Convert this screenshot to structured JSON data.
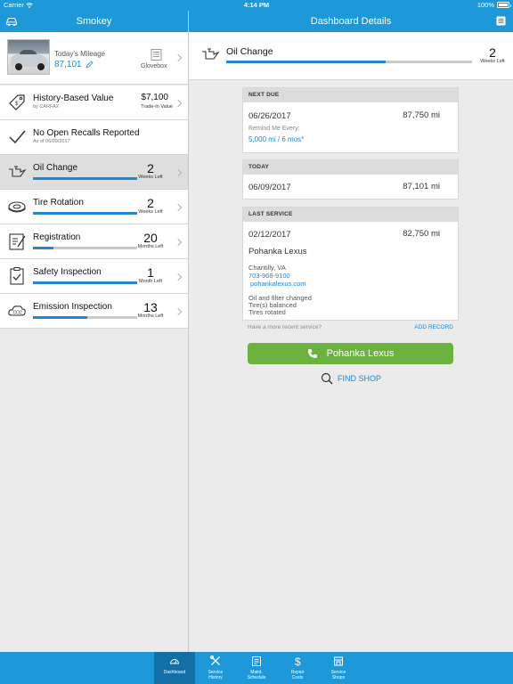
{
  "status_bar": {
    "carrier": "Carrier",
    "time": "4:14 PM",
    "battery": "100%"
  },
  "left_nav": {
    "title": "Smokey",
    "left_icon": "car-icon"
  },
  "right_nav": {
    "title": "Dashboard Details",
    "right_icon": "list-icon"
  },
  "vehicle": {
    "mileage_label": "Today's Mileage",
    "mileage_value": "87,101",
    "glovebox_label": "Glovebox"
  },
  "history_value": {
    "label": "History-Based Value",
    "sub": "by CARFAX",
    "value": "$7,100",
    "value_sub": "Trade-In Value"
  },
  "recalls": {
    "label": "No Open Recalls Reported",
    "sub": "As of 06/09/2017"
  },
  "services": [
    {
      "label": "Oil Change",
      "count": "2",
      "unit": "Weeks Left",
      "progress": 1.0,
      "icon": "oil-can-icon"
    },
    {
      "label": "Tire Rotation",
      "count": "2",
      "unit": "Weeks Left",
      "progress": 1.0,
      "icon": "tire-icon"
    },
    {
      "label": "Registration",
      "count": "20",
      "unit": "Months Left",
      "progress": 0.2,
      "icon": "registration-icon"
    },
    {
      "label": "Safety Inspection",
      "count": "1",
      "unit": "Month Left",
      "progress": 1.0,
      "icon": "clipboard-check-icon"
    },
    {
      "label": "Emission Inspection",
      "count": "13",
      "unit": "Months Left",
      "progress": 0.52,
      "icon": "co2-cloud-icon"
    }
  ],
  "detail": {
    "title": "Oil Change",
    "count": "2",
    "unit": "Weeks Left",
    "progress": 0.65,
    "next_due": {
      "header": "NEXT DUE",
      "date": "06/26/2017",
      "miles": "87,750 mi",
      "remind_label": "Remind Me Every:",
      "remind_value": "5,000 mi / 6 mos*"
    },
    "today": {
      "header": "TODAY",
      "date": "06/09/2017",
      "miles": "87,101 mi"
    },
    "last_service": {
      "header": "LAST SERVICE",
      "date": "02/12/2017",
      "miles": "82,750 mi",
      "shop": "Pohanka Lexus",
      "city": "Chantilly, VA",
      "phone": "703-968-9100",
      "website": "pohankalexus.com",
      "work": [
        "Oil and filter changed",
        "Tire(s) balanced",
        "Tires rotated"
      ]
    },
    "recent_prompt": "Have a more recent service?",
    "add_record": "ADD RECORD",
    "shop_button": "Pohanka Lexus",
    "find_shop": "FIND SHOP"
  },
  "tabs": [
    {
      "label": "Dashboard",
      "icon": "dashboard-gauge-icon",
      "active": true
    },
    {
      "label": "Service\nHistory",
      "icon": "wrench-screwdriver-icon",
      "active": false
    },
    {
      "label": "Maint.\nSchedule",
      "icon": "schedule-icon",
      "active": false
    },
    {
      "label": "Repair\nCosts",
      "icon": "dollar-icon",
      "active": false
    },
    {
      "label": "Service\nShops",
      "icon": "shop-icon",
      "active": false
    }
  ],
  "colors": {
    "brand": "#1e98d8",
    "progress": "#1e88d0",
    "button_green": "#6bb23e"
  }
}
